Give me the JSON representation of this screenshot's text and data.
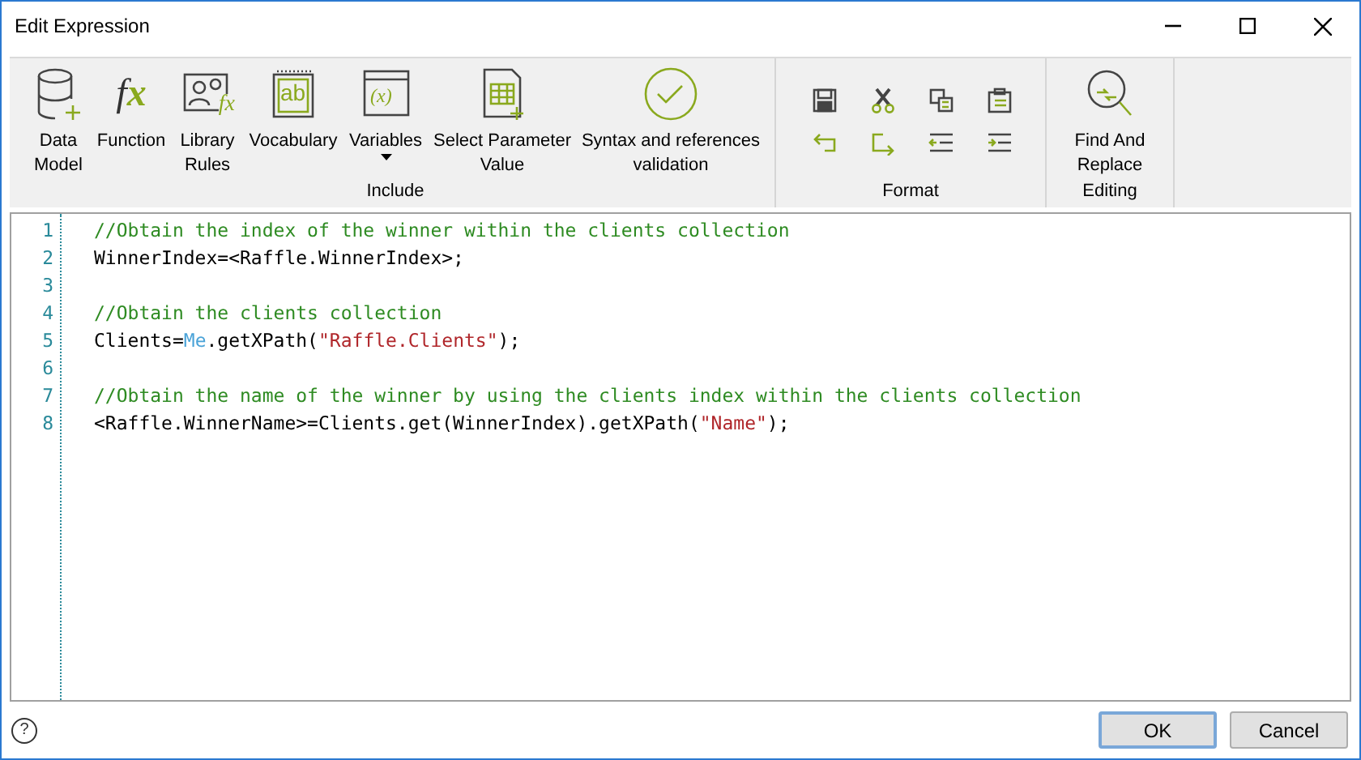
{
  "window": {
    "title": "Edit Expression"
  },
  "ribbon": {
    "groups": [
      {
        "label": "Include",
        "kind": "large",
        "items": [
          {
            "label": "Data Model",
            "dropdown": false
          },
          {
            "label": "Function",
            "icon_text": "fx",
            "dropdown": false
          },
          {
            "label": "Library Rules",
            "icon_text": "fx",
            "dropdown": false
          },
          {
            "label": "Vocabulary",
            "icon_text": "ab",
            "dropdown": false
          },
          {
            "label": "Variables",
            "icon_text": "(x)",
            "dropdown": true
          },
          {
            "label": "Select Parameter Value",
            "dropdown": false
          },
          {
            "label": "Syntax and references validation",
            "dropdown": false
          }
        ]
      },
      {
        "label": "Format",
        "kind": "small"
      },
      {
        "label": "Editing",
        "kind": "large",
        "items": [
          {
            "label": "Find And Replace",
            "dropdown": false
          }
        ]
      }
    ]
  },
  "help": {
    "text": "?"
  },
  "editor": {
    "lines": [
      {
        "number": "1",
        "tokens": [
          {
            "kind": "comment",
            "text": "//Obtain the index of the winner within the clients collection"
          }
        ]
      },
      {
        "number": "2",
        "tokens": [
          {
            "kind": "plain",
            "text": "WinnerIndex=<Raffle.WinnerIndex>;"
          }
        ]
      },
      {
        "number": "3"
      },
      {
        "number": "4",
        "tokens": [
          {
            "kind": "comment",
            "text": "//Obtain the clients collection"
          }
        ]
      },
      {
        "number": "5",
        "tokens": [
          {
            "kind": "plain",
            "text": "Clients="
          },
          {
            "kind": "keyword",
            "text": "Me"
          },
          {
            "kind": "plain",
            "text": ".getXPath("
          },
          {
            "kind": "string",
            "text": "\"Raffle.Clients\""
          },
          {
            "kind": "plain",
            "text": ");"
          }
        ]
      },
      {
        "number": "6"
      },
      {
        "number": "7",
        "tokens": [
          {
            "kind": "comment",
            "text": "//Obtain the name of the winner by using the clients index within the clients collection"
          }
        ]
      },
      {
        "number": "8",
        "tokens": [
          {
            "kind": "plain",
            "text": "<Raffle.WinnerName>=Clients.get(WinnerIndex).getXPath("
          },
          {
            "kind": "string",
            "text": "\"Name\""
          },
          {
            "kind": "plain",
            "text": ");"
          }
        ]
      }
    ]
  },
  "buttons": [
    {
      "label": "OK",
      "default": true
    },
    {
      "label": "Cancel",
      "default": false
    }
  ]
}
